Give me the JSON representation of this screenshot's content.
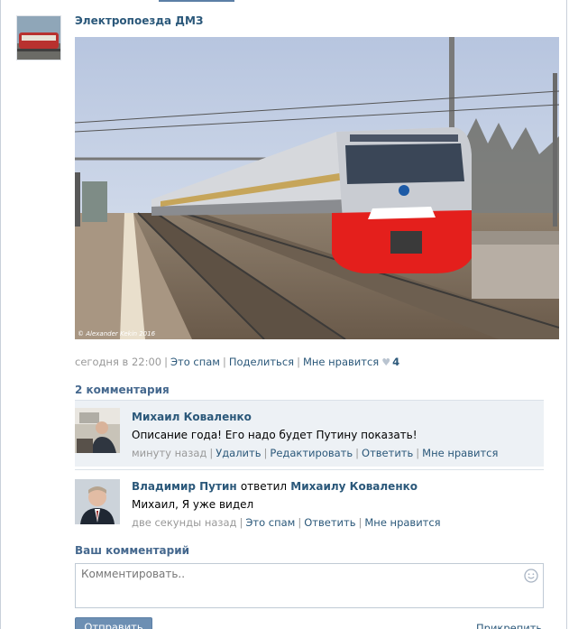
{
  "post": {
    "author": "Электропоезда ДМЗ",
    "photo": {
      "description_icon": "train-photo",
      "watermark": "© Alexander Kekin 2016"
    },
    "meta": {
      "time": "сегодня в 22:00",
      "spam": "Это спам",
      "share": "Поделиться",
      "like": "Мне нравится",
      "like_count": "4"
    }
  },
  "comments": {
    "count_label": "2 комментария",
    "items": [
      {
        "author": "Михаил Коваленко",
        "text": "Описание года! Его надо будет Путину показать!",
        "time": "минуту назад",
        "actions": [
          "Удалить",
          "Редактировать",
          "Ответить",
          "Мне нравится"
        ]
      },
      {
        "author": "Владимир Путин",
        "reply_word": "ответил",
        "reply_to": "Михаилу Коваленко",
        "text": "Михаил, Я уже видел",
        "time": "две секунды назад",
        "actions": [
          "Это спам",
          "Ответить",
          "Мне нравится"
        ]
      }
    ]
  },
  "composer": {
    "heading": "Ваш комментарий",
    "placeholder": "Комментировать..",
    "send_label": "Отправить",
    "attach_label": "Прикрепить"
  },
  "colors": {
    "link": "#2b587a",
    "header": "#45688e",
    "muted": "#999999",
    "button": "#6d8fb3",
    "highlight": "#edf1f5"
  }
}
